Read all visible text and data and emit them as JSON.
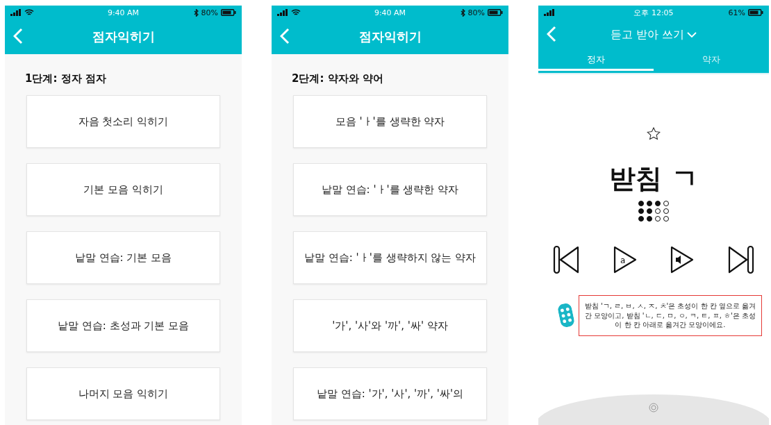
{
  "screens": [
    {
      "status": {
        "time": "9:40 AM",
        "battery": "80%"
      },
      "title": "점자익히기",
      "section": "1단계: 정자 점자",
      "items": [
        "자음 첫소리 익히기",
        "기본 모음 익히기",
        "낱말 연습: 기본 모음",
        "낱말 연습: 초성과 기본 모음",
        "나머지 모음 익히기"
      ]
    },
    {
      "status": {
        "time": "9:40 AM",
        "battery": "80%"
      },
      "title": "점자익히기",
      "section": "2단계: 약자와 약어",
      "items": [
        "모음 'ㅏ'를 생략한 약자",
        "낱말 연습:  'ㅏ'를 생략한 약자",
        "낱말 연습: 'ㅏ'를 생략하지 않는 약자",
        "'가', '사'와 '까', '싸' 약자",
        "낱말 연습: '가', '사', '까', '싸'의"
      ]
    }
  ],
  "practice": {
    "status": {
      "time": "오후 12:05",
      "battery": "61%"
    },
    "title": "듣고 받아 쓰기",
    "tabs": [
      {
        "label": "정자",
        "selected": true
      },
      {
        "label": "약자",
        "selected": false
      }
    ],
    "starred": false,
    "letter_button": "a",
    "word": "받침 ㄱ",
    "braille": [
      {
        "filled": true
      },
      {
        "filled": true
      },
      {
        "filled": true
      },
      {
        "filled": false
      },
      {
        "filled": true
      },
      {
        "filled": true
      },
      {
        "filled": false
      },
      {
        "filled": false
      },
      {
        "filled": true
      },
      {
        "filled": true
      },
      {
        "filled": false
      },
      {
        "filled": false
      }
    ],
    "hint": "받침 'ㄱ, ㄹ, ㅂ, ㅅ, ㅈ, ㅊ'은 초성이 한 칸 옆으로 옮겨간 모양이고, 받침 'ㄴ, ㄷ, ㅁ, ㅇ, ㅋ, ㅌ, ㅍ, ㅎ'은 초성이 한 칸 아래로 옮겨간 모양이에요."
  }
}
